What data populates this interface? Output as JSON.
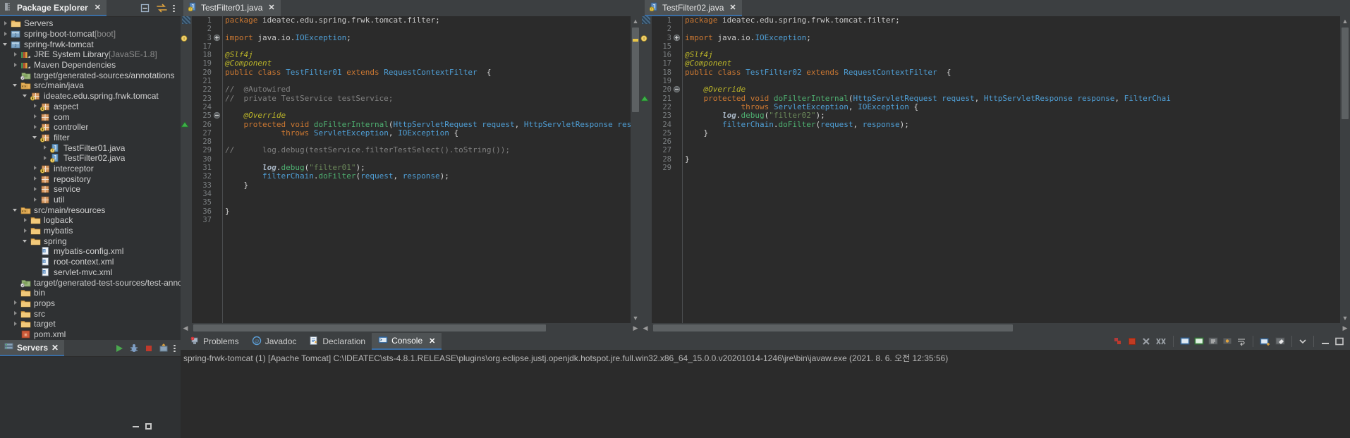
{
  "package_explorer": {
    "tab_label": "Package Explorer",
    "close_label": "✕",
    "toolbar": [
      "collapse-all-icon",
      "link-with-editor-icon",
      "view-menu-icon"
    ],
    "tree": [
      {
        "depth": 0,
        "arrow": "right",
        "icon": "folder-servers",
        "label": "Servers",
        "suffix": ""
      },
      {
        "depth": 0,
        "arrow": "right",
        "icon": "java-project",
        "label": "spring-boot-tomcat",
        "suffix": " [boot]"
      },
      {
        "depth": 0,
        "arrow": "down",
        "icon": "java-project",
        "label": "spring-frwk-tomcat",
        "suffix": ""
      },
      {
        "depth": 1,
        "arrow": "right",
        "icon": "library",
        "label": "JRE System Library",
        "suffix": " [JavaSE-1.8]"
      },
      {
        "depth": 1,
        "arrow": "right",
        "icon": "library",
        "label": "Maven Dependencies",
        "suffix": ""
      },
      {
        "depth": 1,
        "arrow": "none",
        "icon": "source-folder-gen",
        "label": "target/generated-sources/annotations",
        "suffix": ""
      },
      {
        "depth": 1,
        "arrow": "down",
        "icon": "source-folder",
        "label": "src/main/java",
        "suffix": ""
      },
      {
        "depth": 2,
        "arrow": "down",
        "icon": "package-lock",
        "label": "ideatec.edu.spring.frwk.tomcat",
        "suffix": ""
      },
      {
        "depth": 3,
        "arrow": "right",
        "icon": "package-lock",
        "label": "aspect",
        "suffix": ""
      },
      {
        "depth": 3,
        "arrow": "right",
        "icon": "package",
        "label": "com",
        "suffix": ""
      },
      {
        "depth": 3,
        "arrow": "right",
        "icon": "package-lock",
        "label": "controller",
        "suffix": ""
      },
      {
        "depth": 3,
        "arrow": "down",
        "icon": "package-lock",
        "label": "filter",
        "suffix": ""
      },
      {
        "depth": 4,
        "arrow": "right",
        "icon": "java-file",
        "label": "TestFilter01.java",
        "suffix": ""
      },
      {
        "depth": 4,
        "arrow": "right",
        "icon": "java-file",
        "label": "TestFilter02.java",
        "suffix": ""
      },
      {
        "depth": 3,
        "arrow": "right",
        "icon": "package-lock",
        "label": "interceptor",
        "suffix": ""
      },
      {
        "depth": 3,
        "arrow": "right",
        "icon": "package",
        "label": "repository",
        "suffix": ""
      },
      {
        "depth": 3,
        "arrow": "right",
        "icon": "package",
        "label": "service",
        "suffix": ""
      },
      {
        "depth": 3,
        "arrow": "right",
        "icon": "package",
        "label": "util",
        "suffix": ""
      },
      {
        "depth": 1,
        "arrow": "down",
        "icon": "source-folder",
        "label": "src/main/resources",
        "suffix": ""
      },
      {
        "depth": 2,
        "arrow": "right",
        "icon": "folder",
        "label": "logback",
        "suffix": ""
      },
      {
        "depth": 2,
        "arrow": "right",
        "icon": "folder",
        "label": "mybatis",
        "suffix": ""
      },
      {
        "depth": 2,
        "arrow": "down",
        "icon": "folder",
        "label": "spring",
        "suffix": ""
      },
      {
        "depth": 3,
        "arrow": "none",
        "icon": "xml-file",
        "label": "mybatis-config.xml",
        "suffix": ""
      },
      {
        "depth": 3,
        "arrow": "none",
        "icon": "xml-file",
        "label": "root-context.xml",
        "suffix": ""
      },
      {
        "depth": 3,
        "arrow": "none",
        "icon": "xml-file",
        "label": "servlet-mvc.xml",
        "suffix": ""
      },
      {
        "depth": 1,
        "arrow": "none",
        "icon": "source-folder-gen",
        "label": "target/generated-test-sources/test-annotations",
        "suffix": ""
      },
      {
        "depth": 1,
        "arrow": "none",
        "icon": "folder",
        "label": "bin",
        "suffix": ""
      },
      {
        "depth": 1,
        "arrow": "right",
        "icon": "folder",
        "label": "props",
        "suffix": ""
      },
      {
        "depth": 1,
        "arrow": "right",
        "icon": "folder",
        "label": "src",
        "suffix": ""
      },
      {
        "depth": 1,
        "arrow": "right",
        "icon": "folder",
        "label": "target",
        "suffix": ""
      },
      {
        "depth": 1,
        "arrow": "none",
        "icon": "maven-pom",
        "label": "pom.xml",
        "suffix": ""
      }
    ]
  },
  "servers_view": {
    "tab_label": "Servers",
    "close_label": "✕",
    "toolbar": [
      "start-icon",
      "debug-icon",
      "stop-icon",
      "publish-icon",
      "view-menu-icon"
    ]
  },
  "editor_left": {
    "tab": {
      "label": "TestFilter01.java",
      "close_label": "✕",
      "active": false,
      "icon": "java-file-warning"
    },
    "lines": [
      {
        "num": "1",
        "fold": "",
        "ann": "occurrence",
        "text": "package ideatec.edu.spring.frwk.tomcat.filter;"
      },
      {
        "num": "2",
        "fold": "",
        "ann": "",
        "text": ""
      },
      {
        "num": "3",
        "fold": "plus",
        "ann": "warning",
        "text": "import java.io.IOException;"
      },
      {
        "num": "17",
        "fold": "",
        "ann": "",
        "text": ""
      },
      {
        "num": "18",
        "fold": "",
        "ann": "",
        "text": "@Slf4j"
      },
      {
        "num": "19",
        "fold": "",
        "ann": "",
        "text": "@Component"
      },
      {
        "num": "20",
        "fold": "",
        "ann": "",
        "text": "public class TestFilter01 extends RequestContextFilter  {"
      },
      {
        "num": "21",
        "fold": "",
        "ann": "",
        "text": ""
      },
      {
        "num": "22",
        "fold": "",
        "ann": "",
        "text": "//  @Autowired"
      },
      {
        "num": "23",
        "fold": "",
        "ann": "",
        "text": "//  private TestService testService;"
      },
      {
        "num": "24",
        "fold": "",
        "ann": "",
        "text": ""
      },
      {
        "num": "25",
        "fold": "minus",
        "ann": "",
        "text": "    @Override"
      },
      {
        "num": "26",
        "fold": "",
        "ann": "override",
        "text": "    protected void doFilterInternal(HttpServletRequest request, HttpServletResponse response, FilterChai"
      },
      {
        "num": "27",
        "fold": "",
        "ann": "",
        "text": "            throws ServletException, IOException {"
      },
      {
        "num": "28",
        "fold": "",
        "ann": "",
        "text": ""
      },
      {
        "num": "29",
        "fold": "",
        "ann": "",
        "text": "//      log.debug(testService.filterTestSelect().toString());"
      },
      {
        "num": "30",
        "fold": "",
        "ann": "",
        "text": ""
      },
      {
        "num": "31",
        "fold": "",
        "ann": "",
        "text": "        log.debug(\"filter01\");"
      },
      {
        "num": "32",
        "fold": "",
        "ann": "",
        "text": "        filterChain.doFilter(request, response);"
      },
      {
        "num": "33",
        "fold": "",
        "ann": "",
        "text": "    }"
      },
      {
        "num": "34",
        "fold": "",
        "ann": "",
        "text": ""
      },
      {
        "num": "35",
        "fold": "",
        "ann": "",
        "text": ""
      },
      {
        "num": "36",
        "fold": "",
        "ann": "",
        "text": "}"
      },
      {
        "num": "37",
        "fold": "",
        "ann": "",
        "text": ""
      }
    ]
  },
  "editor_right": {
    "tab": {
      "label": "TestFilter02.java",
      "close_label": "✕",
      "active": true,
      "icon": "java-file-warning"
    },
    "lines": [
      {
        "num": "1",
        "fold": "",
        "ann": "occurrence",
        "text": "package ideatec.edu.spring.frwk.tomcat.filter;"
      },
      {
        "num": "2",
        "fold": "",
        "ann": "",
        "text": ""
      },
      {
        "num": "3",
        "fold": "plus",
        "ann": "warning",
        "text": "import java.io.IOException;"
      },
      {
        "num": "15",
        "fold": "",
        "ann": "",
        "text": ""
      },
      {
        "num": "16",
        "fold": "",
        "ann": "",
        "text": "@Slf4j"
      },
      {
        "num": "17",
        "fold": "",
        "ann": "",
        "text": "@Component"
      },
      {
        "num": "18",
        "fold": "",
        "ann": "",
        "text": "public class TestFilter02 extends RequestContextFilter  {"
      },
      {
        "num": "19",
        "fold": "",
        "ann": "",
        "text": ""
      },
      {
        "num": "20",
        "fold": "minus",
        "ann": "",
        "text": "    @Override"
      },
      {
        "num": "21",
        "fold": "",
        "ann": "override",
        "text": "    protected void doFilterInternal(HttpServletRequest request, HttpServletResponse response, FilterChai"
      },
      {
        "num": "22",
        "fold": "",
        "ann": "",
        "text": "            throws ServletException, IOException {"
      },
      {
        "num": "23",
        "fold": "",
        "ann": "",
        "text": "        log.debug(\"filter02\");"
      },
      {
        "num": "24",
        "fold": "",
        "ann": "",
        "text": "        filterChain.doFilter(request, response);"
      },
      {
        "num": "25",
        "fold": "",
        "ann": "",
        "text": "    }"
      },
      {
        "num": "26",
        "fold": "",
        "ann": "",
        "text": ""
      },
      {
        "num": "27",
        "fold": "",
        "ann": "",
        "text": ""
      },
      {
        "num": "28",
        "fold": "",
        "ann": "",
        "text": "}"
      },
      {
        "num": "29",
        "fold": "",
        "ann": "",
        "text": ""
      }
    ]
  },
  "bottom_panel": {
    "tabs": [
      {
        "label": "Problems",
        "icon": "problems-icon",
        "active": false
      },
      {
        "label": "Javadoc",
        "icon": "javadoc-icon",
        "active": false
      },
      {
        "label": "Declaration",
        "icon": "declaration-icon",
        "active": false
      },
      {
        "label": "Console",
        "icon": "console-icon",
        "active": true
      }
    ],
    "close_label": "✕",
    "toolbar": [
      "terminate-all-icon",
      "stop-icon",
      "remove-launch-icon",
      "remove-all-launches-icon",
      "display-selected-console-icon",
      "open-console-icon",
      "scroll-lock-icon",
      "pin-console-icon",
      "word-wrap-icon",
      "new-console-view-icon",
      "clear-console-icon",
      "view-menu-icon",
      "minimize-icon",
      "maximize-icon"
    ],
    "console_text": "spring-frwk-tomcat (1) [Apache Tomcat] C:\\IDEATEC\\sts-4.8.1.RELEASE\\plugins\\org.eclipse.justj.openjdk.hotspot.jre.full.win32.x86_64_15.0.0.v20201014-1246\\jre\\bin\\javaw.exe  (2021. 8. 6. 오전 12:35:56)"
  },
  "colors": {
    "accent": "#3a6ea5",
    "editor_bg": "#2b2b2b",
    "panel_bg": "#3c3f41",
    "tree_bg": "#2f3133",
    "keyword": "#cc7832",
    "string": "#6a8759",
    "comment": "#808080",
    "type": "#4f9fd6",
    "method": "#4eb071",
    "annotation": "#bbb529",
    "error_red": "#d13438"
  }
}
